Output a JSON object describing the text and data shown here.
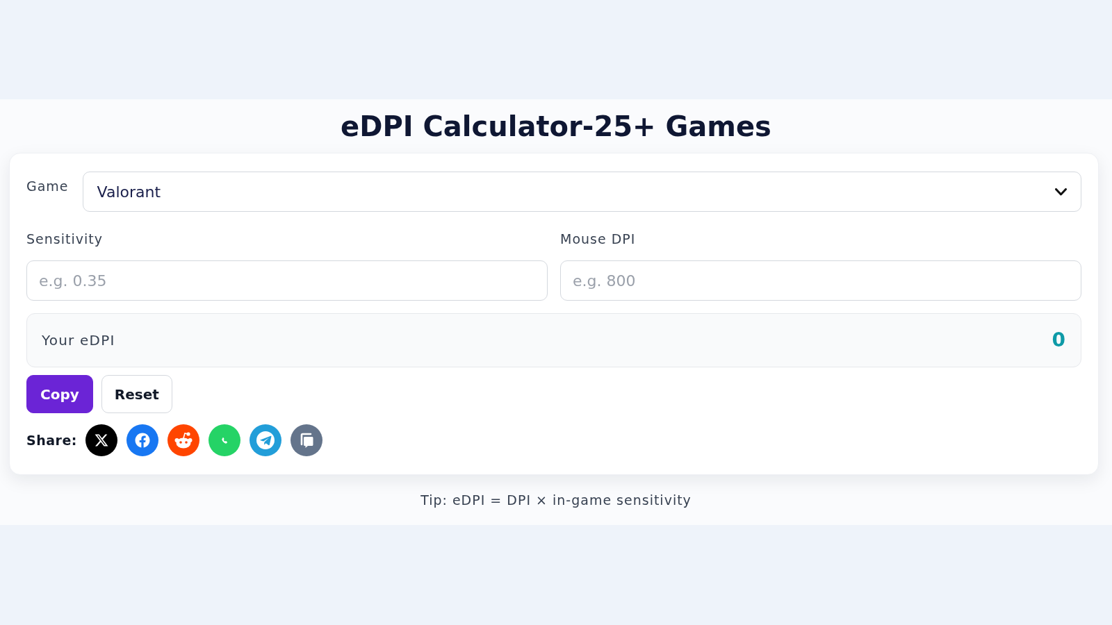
{
  "title": "eDPI Calculator-25+ Games",
  "game": {
    "label": "Game",
    "value": "Valorant"
  },
  "fields": [
    {
      "label": "Sensitivity",
      "placeholder": "e.g. 0.35"
    },
    {
      "label": "Mouse DPI",
      "placeholder": "e.g. 800"
    }
  ],
  "result": {
    "label": "Your eDPI",
    "value": "0"
  },
  "buttons": [
    {
      "label": "Copy",
      "kind": "primary"
    },
    {
      "label": "Reset",
      "kind": "secondary"
    }
  ],
  "share": {
    "label": "Share:",
    "services": [
      {
        "kind": "x",
        "color": "#000000"
      },
      {
        "kind": "facebook",
        "color": "#1877f2"
      },
      {
        "kind": "reddit",
        "color": "#ff4500"
      },
      {
        "kind": "phone",
        "color": "#25d366"
      },
      {
        "kind": "plane",
        "color": "#229ed9"
      },
      {
        "kind": "copy",
        "color": "#64748b"
      }
    ]
  },
  "tip": "Tip: eDPI = DPI × in-game sensitivity"
}
